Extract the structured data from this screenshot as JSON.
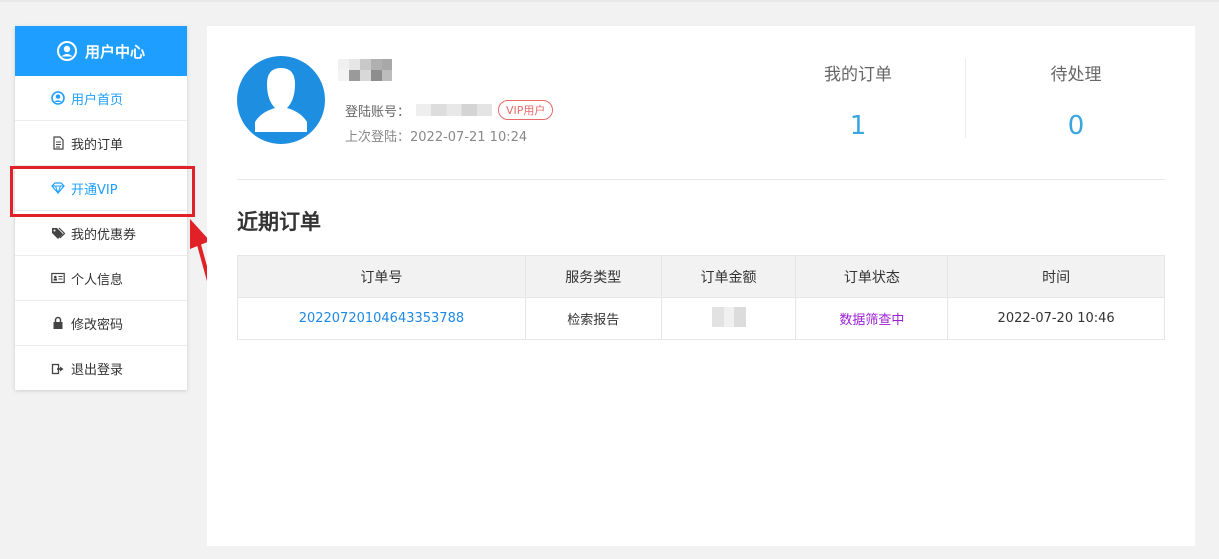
{
  "sidebar": {
    "title": "用户中心",
    "items": [
      {
        "label": "用户首页"
      },
      {
        "label": "我的订单"
      },
      {
        "label": "开通VIP"
      },
      {
        "label": "我的优惠券"
      },
      {
        "label": "个人信息"
      },
      {
        "label": "修改密码"
      },
      {
        "label": "退出登录"
      }
    ]
  },
  "profile": {
    "login_account_label": "登陆账号：",
    "vip_badge": "VIP用户",
    "last_login": "上次登陆：2022-07-21 10:24"
  },
  "stats": {
    "orders_label": "我的订单",
    "orders_value": "1",
    "pending_label": "待处理",
    "pending_value": "0"
  },
  "recent": {
    "title": "近期订单",
    "columns": [
      "订单号",
      "服务类型",
      "订单金额",
      "订单状态",
      "时间"
    ],
    "rows": [
      {
        "order_no": "20220720104643353788",
        "service": "检索报告",
        "status": "数据筛查中",
        "time": "2022-07-20 10:46"
      }
    ]
  },
  "colors": {
    "accent": "#1e9fff",
    "highlight_box": "#e02127",
    "status": "#9b1fd6"
  }
}
